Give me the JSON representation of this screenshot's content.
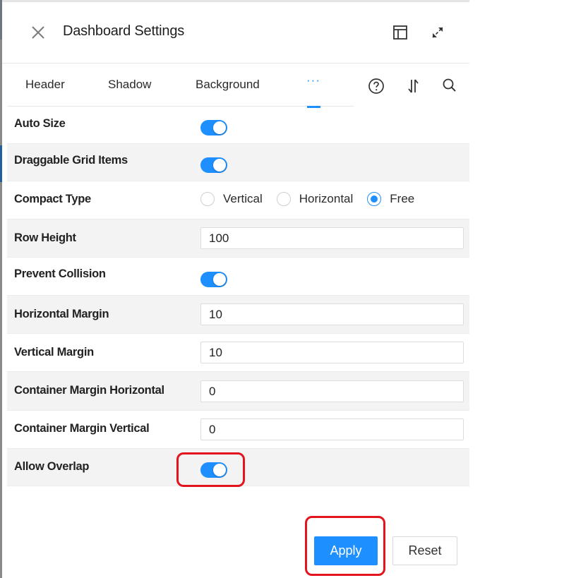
{
  "header": {
    "title": "Dashboard Settings",
    "icons": {
      "close": "close-icon",
      "layout": "layout-panel-icon",
      "expand": "expand-icon"
    }
  },
  "tabs": {
    "items": [
      {
        "label": "Header",
        "active": false
      },
      {
        "label": "Shadow",
        "active": false
      },
      {
        "label": "Background",
        "active": false
      },
      {
        "label": "···",
        "active": true
      }
    ],
    "icons": [
      "help-icon",
      "sort-icon",
      "search-icon"
    ]
  },
  "settings": {
    "auto_size": {
      "label": "Auto Size",
      "value": true
    },
    "draggable_grid_items": {
      "label": "Draggable Grid Items",
      "value": true
    },
    "compact_type": {
      "label": "Compact Type",
      "options": [
        "Vertical",
        "Horizontal",
        "Free"
      ],
      "selected": "Free"
    },
    "row_height": {
      "label": "Row Height",
      "value": "100"
    },
    "prevent_collision": {
      "label": "Prevent Collision",
      "value": true
    },
    "horizontal_margin": {
      "label": "Horizontal Margin",
      "value": "10"
    },
    "vertical_margin": {
      "label": "Vertical Margin",
      "value": "10"
    },
    "container_margin_horizontal": {
      "label": "Container Margin Horizontal",
      "value": "0"
    },
    "container_margin_vertical": {
      "label": "Container Margin Vertical",
      "value": "0"
    },
    "allow_overlap": {
      "label": "Allow Overlap",
      "value": true
    }
  },
  "footer": {
    "apply_label": "Apply",
    "reset_label": "Reset"
  },
  "colors": {
    "accent": "#1e8ffe",
    "annotation": "#e3141e",
    "row_alt": "#f3f3f3"
  }
}
